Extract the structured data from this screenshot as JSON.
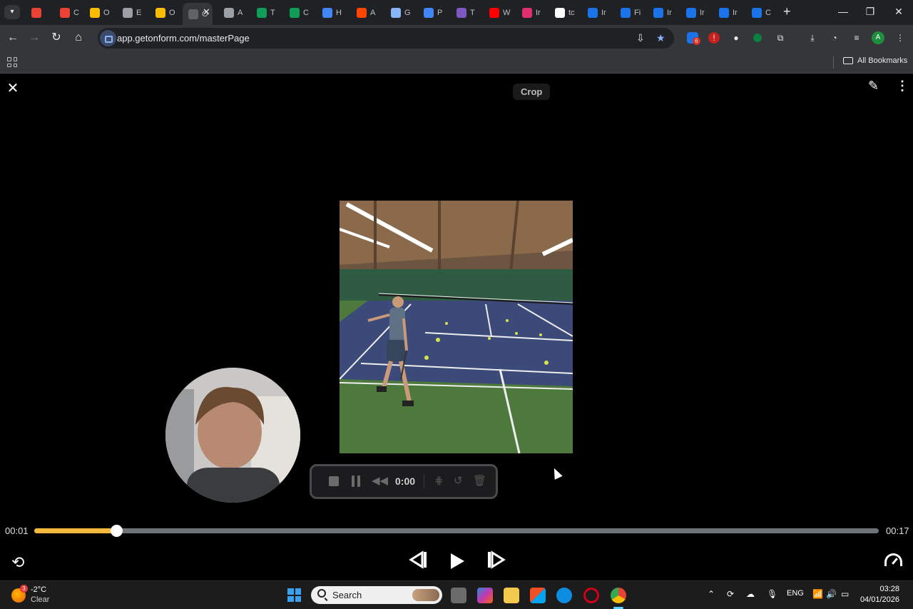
{
  "browser": {
    "tabs": [
      {
        "label": "",
        "color": "#ea4335"
      },
      {
        "label": "C",
        "color": "#ea4335"
      },
      {
        "label": "O",
        "color": "#fbbc04"
      },
      {
        "label": "E",
        "color": "#9aa0a6"
      },
      {
        "label": "O",
        "color": "#fbbc04"
      },
      {
        "label": "O",
        "color": "#5f6368",
        "active": true
      },
      {
        "label": "A",
        "color": "#9aa0a6"
      },
      {
        "label": "T",
        "color": "#0f9d58"
      },
      {
        "label": "C",
        "color": "#0f9d58"
      },
      {
        "label": "H",
        "color": "#4285f4"
      },
      {
        "label": "A",
        "color": "#ff4500"
      },
      {
        "label": "G",
        "color": "#8ab4f8"
      },
      {
        "label": "P",
        "color": "#4285f4"
      },
      {
        "label": "T",
        "color": "#7e57c2"
      },
      {
        "label": "W",
        "color": "#ff0000"
      },
      {
        "label": "Ir",
        "color": "#e1306c"
      },
      {
        "label": "tc",
        "color": "#ffffff"
      },
      {
        "label": "Ir",
        "color": "#1a73e8"
      },
      {
        "label": "Fi",
        "color": "#1a73e8"
      },
      {
        "label": "Ir",
        "color": "#1a73e8"
      },
      {
        "label": "Ir",
        "color": "#1a73e8"
      },
      {
        "label": "Ir",
        "color": "#1a73e8"
      },
      {
        "label": "C",
        "color": "#1a73e8"
      }
    ],
    "url": "app.getonform.com/masterPage",
    "extension_badge": "6",
    "profile_initial": "A",
    "all_bookmarks": "All Bookmarks"
  },
  "editor": {
    "crop_label": "Crop",
    "recorder": {
      "time": "0:00"
    },
    "playback": {
      "current_time": "00:01",
      "total_time": "00:17",
      "progress": 0.097,
      "accent_color": "#f6b93b"
    }
  },
  "taskbar": {
    "weather_badge": "3",
    "weather_temp": "-2°C",
    "weather_desc": "Clear",
    "search_placeholder": "Search",
    "language": "ENG",
    "time": "03:28",
    "date": "04/01/2026"
  },
  "icons": {
    "close": "close-icon",
    "edit": "pencil-icon",
    "menu": "kebab-menu-icon",
    "loop": "loop-icon",
    "prev": "skip-back-icon",
    "play": "play-icon",
    "next": "skip-forward-icon",
    "speed": "speed-gauge-icon"
  }
}
